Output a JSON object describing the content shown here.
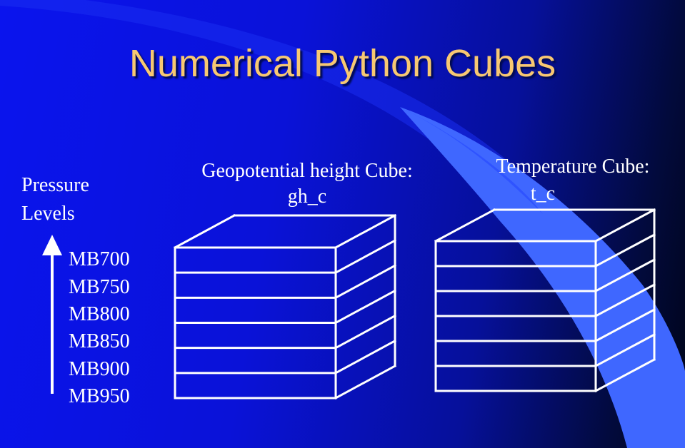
{
  "slide": {
    "title": "Numerical Python Cubes",
    "title_color": "#f7c872",
    "line_color": "#ffffff"
  },
  "axis": {
    "label_line1": "Pressure",
    "label_line2": "Levels",
    "levels": [
      "MB700",
      "MB750",
      "MB800",
      "MB850",
      "MB900",
      "MB950"
    ]
  },
  "cubes": [
    {
      "caption_line1": "Geopotential height Cube:",
      "caption_line2": "gh_c",
      "layers": 6
    },
    {
      "caption_line1": "Temperature Cube:",
      "caption_line2": "t_c",
      "layers": 6
    }
  ]
}
